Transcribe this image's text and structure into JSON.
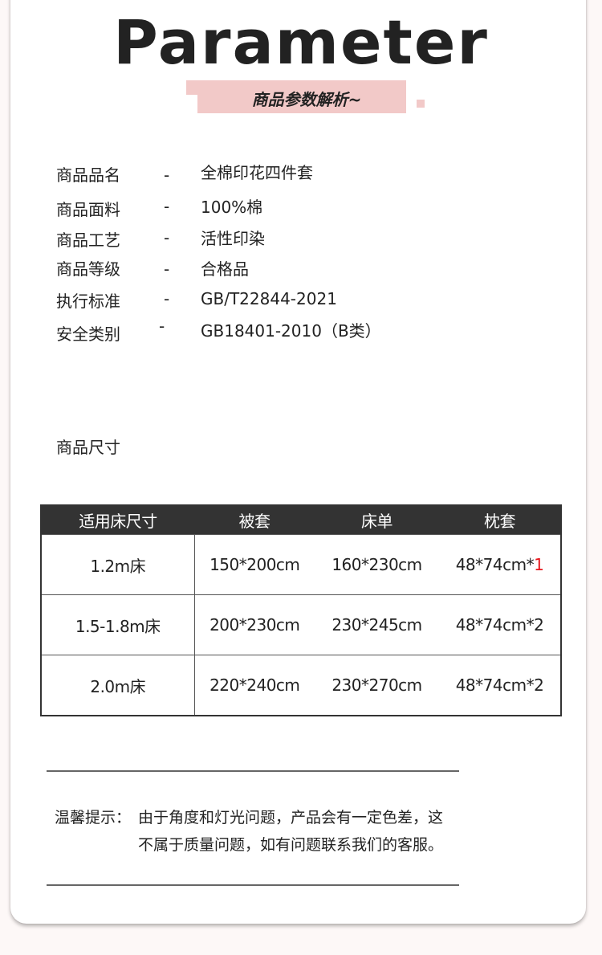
{
  "header": {
    "title": "Parameter",
    "subtitle": "商品参数解析~"
  },
  "params": [
    {
      "label": "商品品名",
      "dash": "-",
      "value": "全棉印花四件套"
    },
    {
      "label": "商品面料",
      "dash": "-",
      "value": "100%棉"
    },
    {
      "label": "商品工艺",
      "dash": "-",
      "value": "活性印染"
    },
    {
      "label": "商品等级",
      "dash": "-",
      "value": "合格品"
    },
    {
      "label": "执行标准",
      "dash": "-",
      "value": "GB/T22844-2021"
    },
    {
      "label": "安全类别",
      "dash": "-",
      "value": "GB18401-2010（B类）"
    }
  ],
  "size_section": {
    "title": "商品尺寸",
    "columns": [
      "适用床尺寸",
      "被套",
      "床单",
      "枕套"
    ],
    "rows": [
      {
        "bed": "1.2m床",
        "duvet": "150*200cm",
        "sheet": "160*230cm",
        "pillow_prefix": "48*74cm*",
        "pillow_qty": "1",
        "qty_highlight": true
      },
      {
        "bed": "1.5-1.8m床",
        "duvet": "200*230cm",
        "sheet": "230*245cm",
        "pillow_prefix": "48*74cm*",
        "pillow_qty": "2",
        "qty_highlight": false
      },
      {
        "bed": "2.0m床",
        "duvet": "220*240cm",
        "sheet": "230*270cm",
        "pillow_prefix": "48*74cm*",
        "pillow_qty": "2",
        "qty_highlight": false
      }
    ]
  },
  "notice": {
    "label": "温馨提示：",
    "line1": "由于角度和灯光问题，产品会有一定色差，这",
    "line2": "不属于质量问题，如有问题联系我们的客服。"
  },
  "colors": {
    "accent_pink": "#f2c9c8",
    "table_header": "#333333",
    "highlight_red": "#e8161c",
    "page_background": "#fdf8f7"
  }
}
